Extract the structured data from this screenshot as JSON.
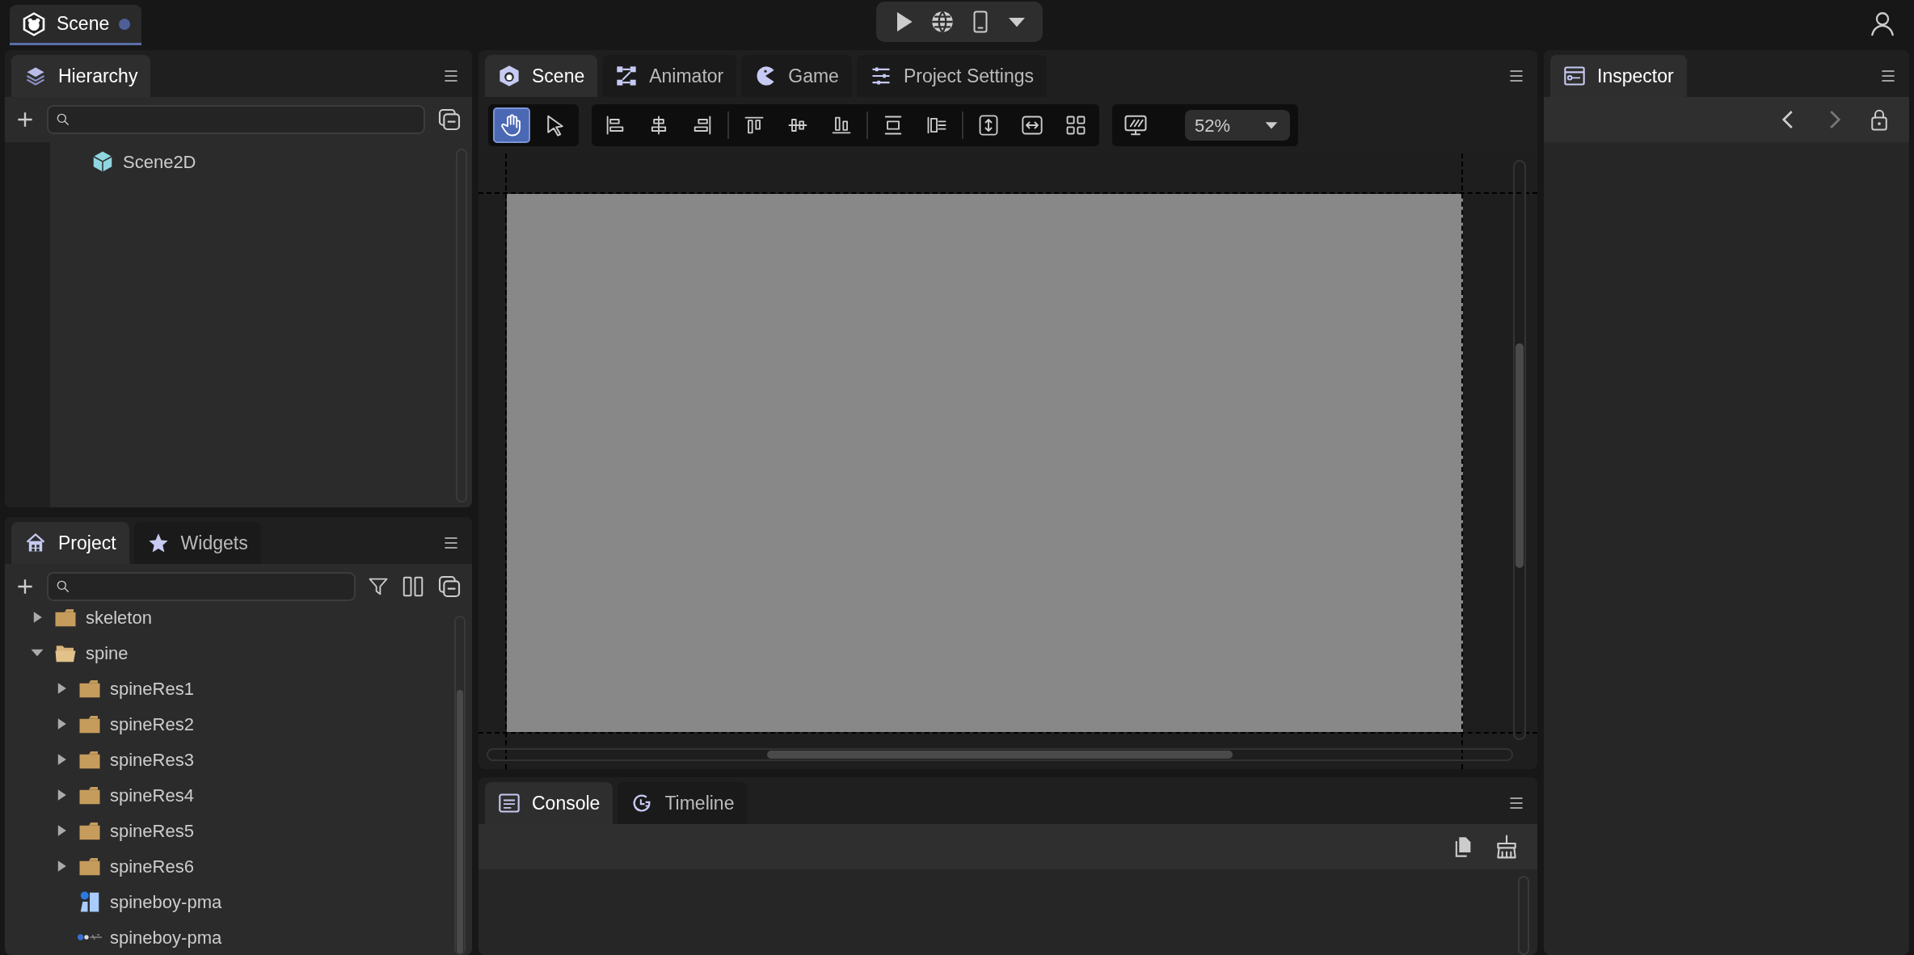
{
  "document_tab": {
    "label": "Scene",
    "modified": true
  },
  "hierarchy": {
    "tabs": [
      {
        "label": "Hierarchy",
        "selected": true
      }
    ],
    "items": [
      {
        "label": "Scene2D",
        "kind": "scene"
      }
    ]
  },
  "project": {
    "tabs": [
      {
        "label": "Project",
        "selected": true
      },
      {
        "label": "Widgets",
        "selected": false
      }
    ],
    "items": [
      {
        "label": "skeleton",
        "kind": "folder",
        "expanded": false
      },
      {
        "label": "spine",
        "kind": "folder",
        "expanded": true,
        "children": [
          {
            "label": "spineRes1",
            "kind": "folder",
            "expanded": false
          },
          {
            "label": "spineRes2",
            "kind": "folder",
            "expanded": false
          },
          {
            "label": "spineRes3",
            "kind": "folder",
            "expanded": false
          },
          {
            "label": "spineRes4",
            "kind": "folder",
            "expanded": false
          },
          {
            "label": "spineRes5",
            "kind": "folder",
            "expanded": false
          },
          {
            "label": "spineRes6",
            "kind": "folder",
            "expanded": false
          },
          {
            "label": "spineboy-pma",
            "kind": "skeleton"
          },
          {
            "label": "spineboy-pma",
            "kind": "image"
          }
        ]
      }
    ]
  },
  "scene_panel": {
    "tabs": [
      {
        "label": "Scene",
        "selected": true
      },
      {
        "label": "Animator",
        "selected": false
      },
      {
        "label": "Game",
        "selected": false
      },
      {
        "label": "Project Settings",
        "selected": false
      }
    ],
    "tools": [
      {
        "kind": "hand",
        "selected": true
      },
      {
        "kind": "pointer",
        "selected": false
      }
    ],
    "zoom": "52%"
  },
  "inspector": {
    "tabs": [
      {
        "label": "Inspector",
        "selected": true
      }
    ]
  },
  "console": {
    "tabs": [
      {
        "label": "Console",
        "selected": true
      },
      {
        "label": "Timeline",
        "selected": false
      }
    ]
  }
}
